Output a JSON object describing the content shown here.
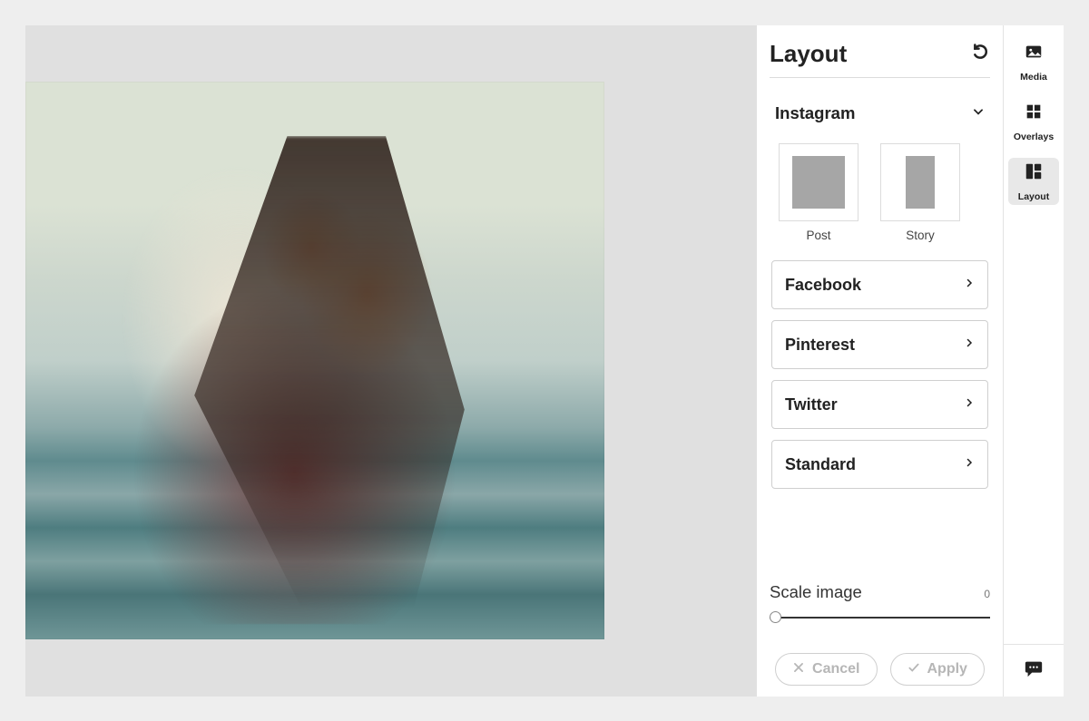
{
  "panel": {
    "title": "Layout",
    "instagram": {
      "label": "Instagram",
      "presets": [
        {
          "label": "Post"
        },
        {
          "label": "Story"
        }
      ]
    },
    "sections": [
      {
        "label": "Facebook"
      },
      {
        "label": "Pinterest"
      },
      {
        "label": "Twitter"
      },
      {
        "label": "Standard"
      }
    ],
    "scale": {
      "label": "Scale image",
      "value": "0"
    },
    "buttons": {
      "cancel": "Cancel",
      "apply": "Apply"
    }
  },
  "rail": {
    "items": [
      {
        "label": "Media"
      },
      {
        "label": "Overlays"
      },
      {
        "label": "Layout"
      }
    ]
  }
}
